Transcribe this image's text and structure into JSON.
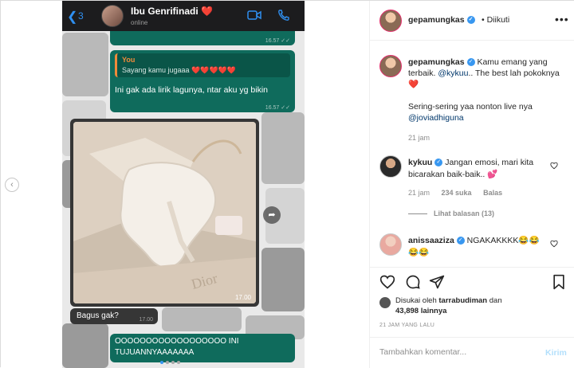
{
  "phone": {
    "back_count": "3",
    "contact_name": "Ibu Genrifinadi",
    "contact_heart": "❤️",
    "contact_status": "online",
    "msg1_time": "16.57 ✓✓",
    "quote_name": "You",
    "quote_text": "Sayang kamu jugaaa ❤️❤️❤️❤️❤️",
    "msg2_text": "Ini gak ada lirik lagunya, ntar aku yg bikin",
    "msg2_time": "16.57 ✓✓",
    "photo_time": "17.00",
    "msg3_text": "Bagus gak?",
    "msg3_time": "17.00",
    "msg4_text": "OOOOOOOOOOOOOOOOOO INI TUJUANNYAAAAAAA"
  },
  "post": {
    "username": "gepamungkas",
    "follow_status": "• Diikuti",
    "more": "•••",
    "caption_user": "gepamungkas",
    "caption_part1": "Kamu emang yang terbaik.",
    "caption_mention1": "@kykuu",
    "caption_part2": ".. The best lah pokoknya",
    "caption_heart": "❤️",
    "caption_line2": "Sering-sering yaa nonton live nya",
    "caption_mention2": "@joviadhiguna",
    "caption_time": "21 jam",
    "comments": [
      {
        "user": "kykuu",
        "text": "Jangan emosi, mari kita bicarakan baik-baik..",
        "emoji": "💕",
        "time": "21 jam",
        "likes": "234 suka",
        "reply": "Balas",
        "view_replies": "Lihat balasan (13)"
      },
      {
        "user": "anissaaziza",
        "text": "NGAKAKKKK😂😂😂😂"
      }
    ],
    "liked_by_prefix": "Disukai oleh",
    "liked_by_user": "tarrabudiman",
    "liked_by_mid": "dan",
    "liked_by_count": "43,898 lainnya",
    "date": "21 JAM YANG LALU",
    "comment_placeholder": "Tambahkan komentar...",
    "send_label": "Kirim"
  }
}
